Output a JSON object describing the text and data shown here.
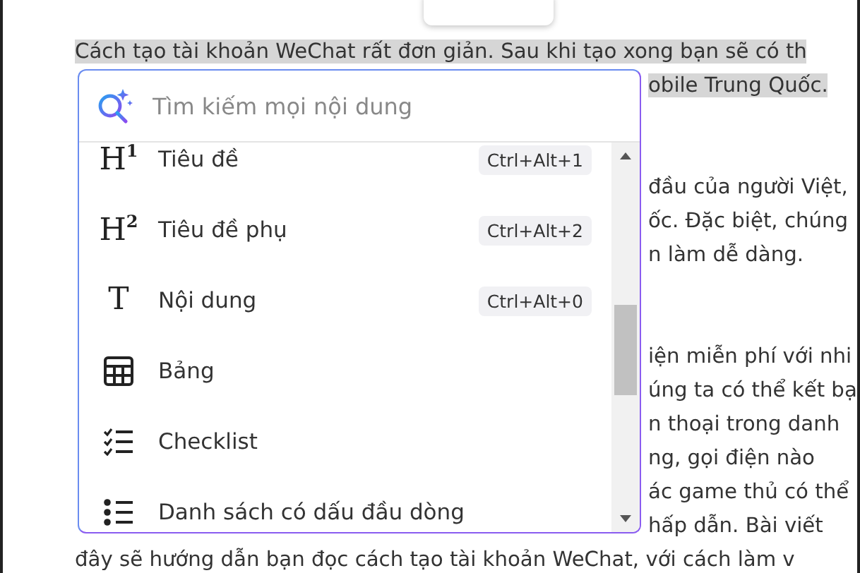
{
  "document": {
    "paragraphs": [
      {
        "lines": [
          {
            "text": "Cách tạo tài khoản WeChat rất đơn giản. Sau khi tạo xong bạn sẽ có th",
            "kind": "full",
            "highlighted": true
          },
          {
            "text": "obile Trung Quốc.",
            "kind": "fragment",
            "highlighted": true
          }
        ]
      },
      {
        "lines": [
          {
            "text": "đầu của người Việt,",
            "kind": "fragment",
            "highlighted": false
          },
          {
            "text": "ốc. Đặc biệt, chúng",
            "kind": "fragment",
            "highlighted": false
          },
          {
            "text": "n làm dễ dàng.",
            "kind": "fragment",
            "highlighted": false
          }
        ]
      },
      {
        "lines": [
          {
            "text": "iện miễn phí với nhi",
            "kind": "fragment",
            "highlighted": false
          },
          {
            "text": "úng ta có thể kết bạ",
            "kind": "fragment",
            "highlighted": false
          },
          {
            "text": "n thoại trong danh",
            "kind": "fragment",
            "highlighted": false
          },
          {
            "text": "ng, gọi điện nào",
            "kind": "fragment",
            "highlighted": false
          },
          {
            "text": "ác game thủ có thể",
            "kind": "fragment",
            "highlighted": false
          },
          {
            "text": "hấp dẫn. Bài viết",
            "kind": "fragment",
            "highlighted": false
          },
          {
            "text": "đây sẽ hướng dẫn bạn đọc cách tạo tài khoản WeChat, với cách làm v",
            "kind": "full",
            "highlighted": false
          }
        ]
      }
    ]
  },
  "insert_menu": {
    "search": {
      "placeholder": "Tìm kiếm mọi nội dung"
    },
    "items": [
      {
        "kind": "heading",
        "glyph": "H$^{1}$",
        "label": "Tiêu đề",
        "shortcut": "Ctrl+Alt+1"
      },
      {
        "kind": "heading",
        "glyph": "H$^{2}$",
        "label": "Tiêu đề phụ",
        "shortcut": "Ctrl+Alt+2"
      },
      {
        "kind": "heading",
        "glyph": "T",
        "label": "Nội dung",
        "shortcut": "Ctrl+Alt+0"
      },
      {
        "kind": "table",
        "label": "Bảng"
      },
      {
        "kind": "checklist",
        "label": "Checklist"
      },
      {
        "kind": "bullets",
        "label": "Danh sách có dấu đầu dòng"
      }
    ]
  }
}
